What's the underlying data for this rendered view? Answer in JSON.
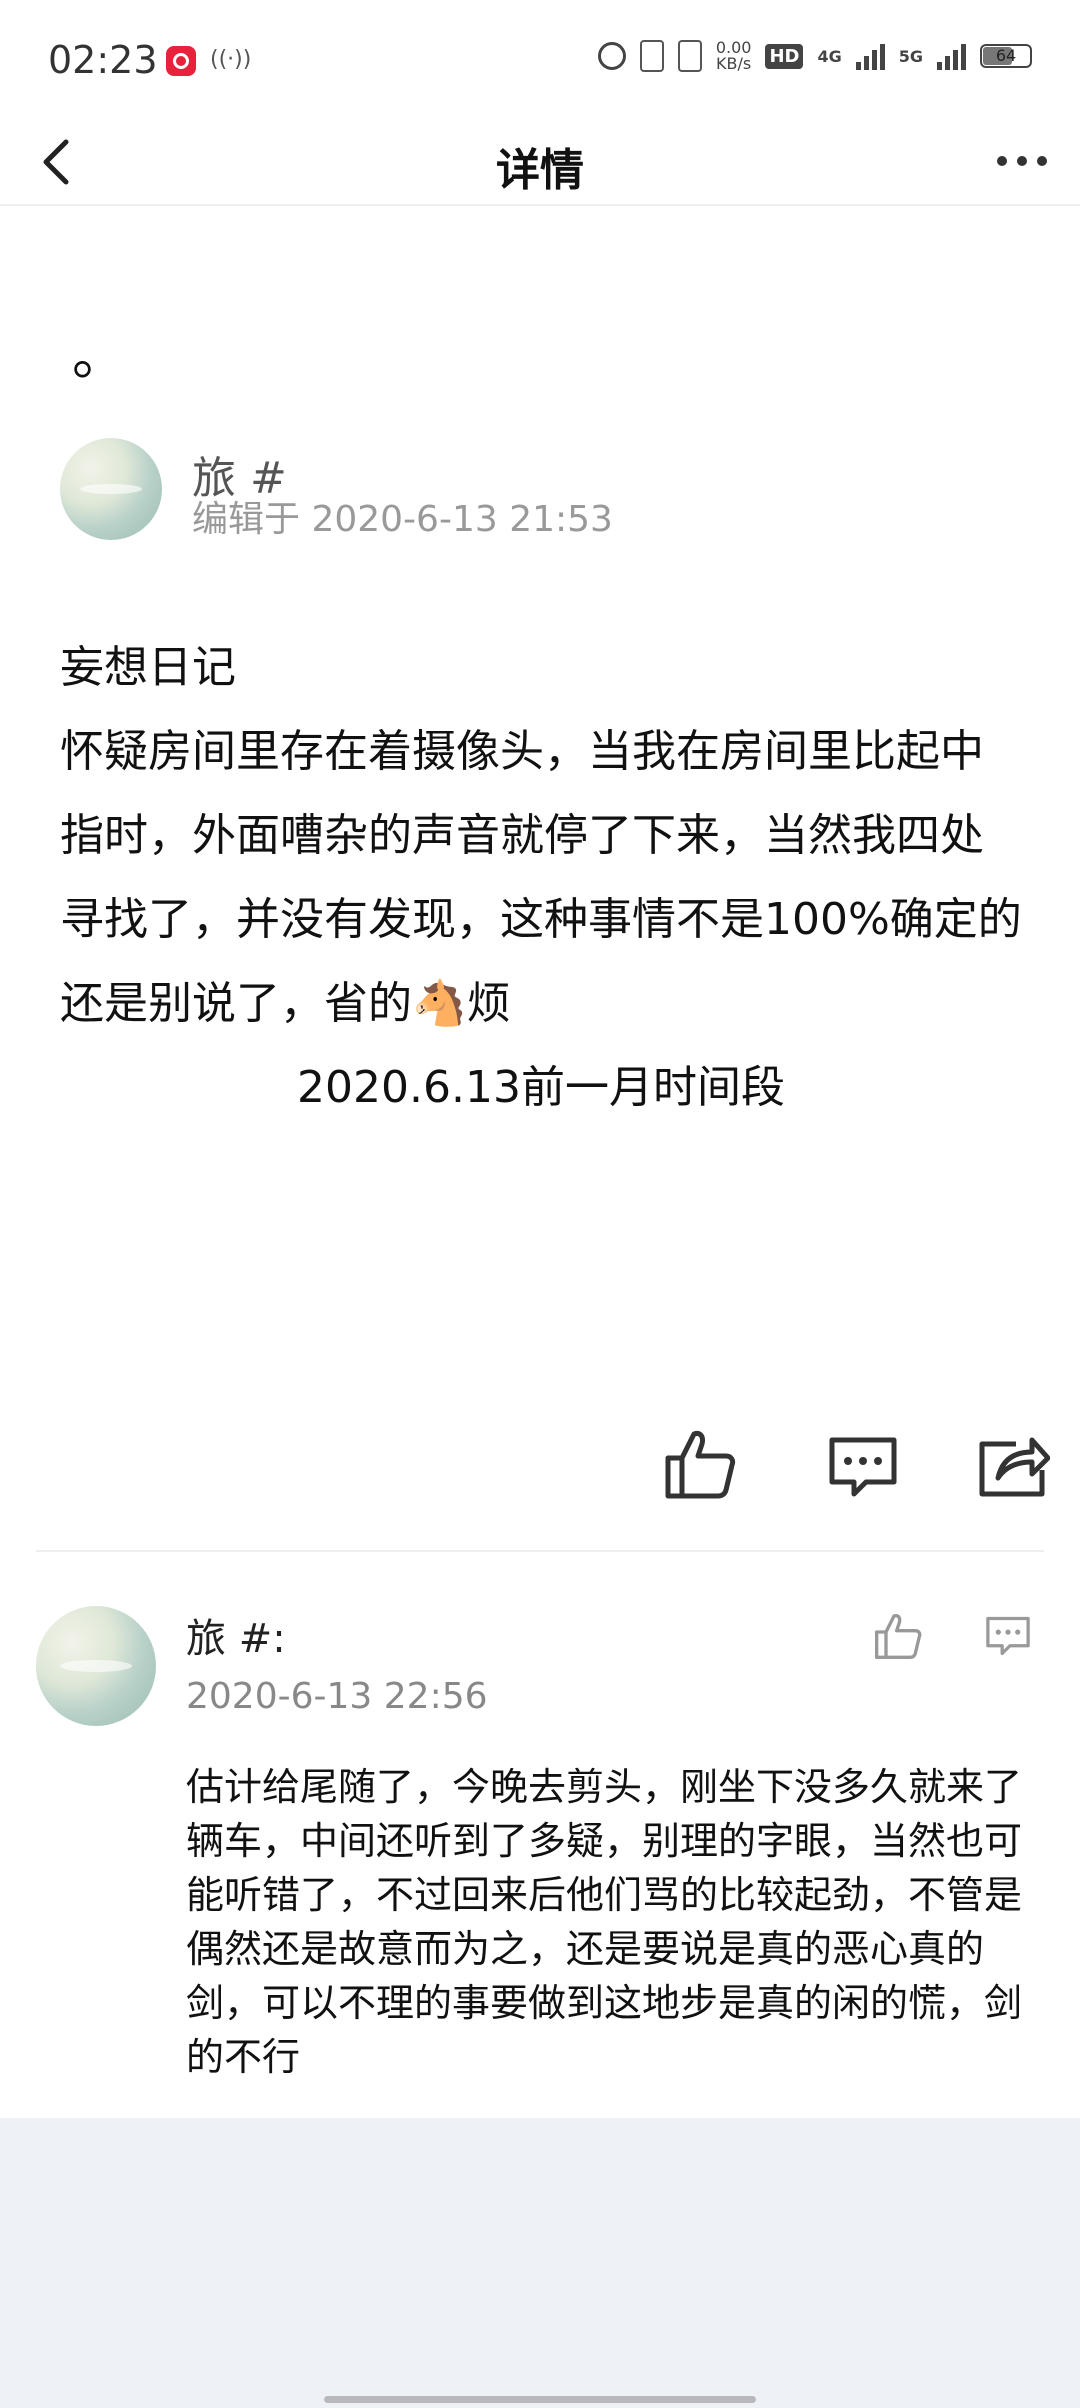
{
  "status_bar": {
    "time": "02:23",
    "speed_value": "0.00",
    "speed_unit": "KB/s",
    "hd_label": "HD",
    "net1": "4G",
    "net2": "5G",
    "battery": "64"
  },
  "header": {
    "title": "详情"
  },
  "post": {
    "title": "。",
    "author": "旅 #",
    "edited": "编辑于 2020-6-13 21:53",
    "body_heading": "妄想日记",
    "body_text": "怀疑房间里存在着摄像头，当我在房间里比起中指时，外面嘈杂的声音就停了下来，当然我四处寻找了，并没有发现，这种事情不是100%确定的还是别说了，省的🐴烦",
    "body_footer": "2020.6.13前一月时间段"
  },
  "comment": {
    "author": "旅 #:",
    "time": "2020-6-13 22:56",
    "text": "估计给尾随了，今晚去剪头，刚坐下没多久就来了辆车，中间还听到了多疑，别理的字眼，当然也可能听错了，不过回来后他们骂的比较起劲，不管是偶然还是故意而为之，还是要说是真的恶心真的剑，可以不理的事要做到这地步是真的闲的慌，剑的不行"
  },
  "icons": {
    "back": "chevron-left-icon",
    "more": "more-dots-icon",
    "like": "thumbs-up-icon",
    "comment": "comment-icon",
    "share": "share-icon"
  }
}
